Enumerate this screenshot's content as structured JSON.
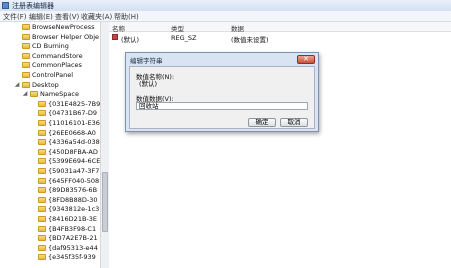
{
  "window": {
    "title": "注册表编辑器"
  },
  "menu": [
    "文件(F)",
    "编辑(E)",
    "查看(V)",
    "收藏夹(A)",
    "帮助(H)"
  ],
  "tree": [
    {
      "label": "BrowseNewProcess",
      "level": 1
    },
    {
      "label": "Browser Helper Obje",
      "level": 1
    },
    {
      "label": "CD Burning",
      "level": 1
    },
    {
      "label": "CommandStore",
      "level": 1
    },
    {
      "label": "CommonPlaces",
      "level": 1
    },
    {
      "label": "ControlPanel",
      "level": 1
    },
    {
      "label": "Desktop",
      "level": 1,
      "expanded": true
    },
    {
      "label": "NameSpace",
      "level": 2,
      "expanded": true
    },
    {
      "label": "{031E4825-7B9",
      "level": 3
    },
    {
      "label": "{04731B67-D9",
      "level": 3
    },
    {
      "label": "{11016101-E36",
      "level": 3
    },
    {
      "label": "{26EE0668-A0",
      "level": 3
    },
    {
      "label": "{4336a54d-038",
      "level": 3
    },
    {
      "label": "{450D8FBA-AD",
      "level": 3
    },
    {
      "label": "{5399E694-6CE",
      "level": 3
    },
    {
      "label": "{59031a47-3F7",
      "level": 3
    },
    {
      "label": "{645FF040-508",
      "level": 3
    },
    {
      "label": "{89D83576-6B",
      "level": 3
    },
    {
      "label": "{8FD8B88D-30",
      "level": 3
    },
    {
      "label": "{9343812e-1c3",
      "level": 3
    },
    {
      "label": "{8416D21B-3E",
      "level": 3
    },
    {
      "label": "{B4FB3F98-C1",
      "level": 3
    },
    {
      "label": "{BD7A2E7B-21",
      "level": 3
    },
    {
      "label": "{daf95313-e44",
      "level": 3
    },
    {
      "label": "{e345f35f-939",
      "level": 3
    }
  ],
  "list": {
    "headers": {
      "name": "名称",
      "type": "类型",
      "data": "数据"
    },
    "rows": [
      {
        "name": "(默认)",
        "type": "REG_SZ",
        "data": "(数值未设置)"
      }
    ]
  },
  "dialog": {
    "title": "编辑字符串",
    "close_label": "✕",
    "name_label": "数值名称(N):",
    "name_value": "(默认)",
    "data_label": "数值数据(V):",
    "data_value": "回收站",
    "ok_label": "确定",
    "cancel_label": "取消"
  }
}
